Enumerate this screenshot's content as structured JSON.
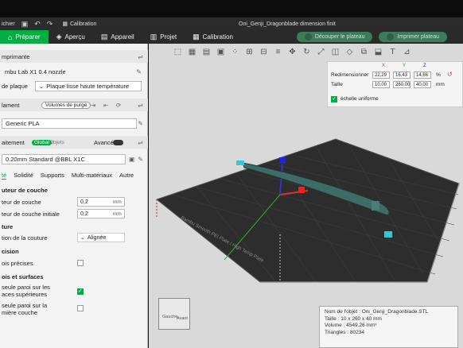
{
  "titlebar": {
    "menu": "ichier",
    "calibration": "Calibration",
    "filename": "Oni_Genji_Dragonblade dimension finit"
  },
  "tabs": [
    {
      "label": "Préparer",
      "icon": "home-icon"
    },
    {
      "label": "Aperçu",
      "icon": "layers-icon"
    },
    {
      "label": "Appareil",
      "icon": "device-icon"
    },
    {
      "label": "Projet",
      "icon": "project-icon"
    },
    {
      "label": "Calibration",
      "icon": "calibration-icon"
    }
  ],
  "actions": {
    "slice": "Découper le plateau",
    "print": "Imprimer plateau"
  },
  "left": {
    "printer_head": "mprimante",
    "printer_name": "mbu Lab X1 0.4 nozzle",
    "plate_label": "de plaque",
    "plate_value": "Plaque lisse haute température",
    "filament_label": "lament",
    "purge_label": "Volumes de purge",
    "filament_value": "Generic PLA",
    "process_label": "aitement",
    "global_label": "Global",
    "objets_label": "Objets",
    "avance_label": "Avancé",
    "profile_value": "0.20mm Standard @BBL X1C",
    "subtabs": [
      "té",
      "Solidité",
      "Supports",
      "Multi-matériaux",
      "Autre"
    ],
    "layer_head": "uteur de couche",
    "layer_height_label": "teur de couche",
    "layer_height_value": "0,2",
    "layer_height_unit": "mm",
    "first_layer_label": "teur de couche initiale",
    "first_layer_value": "0,2",
    "first_layer_unit": "mm",
    "seam_head": "ture",
    "seam_label": "tion de la couture",
    "seam_value": "Alignée",
    "precision_head": "cision",
    "precise_walls_label": "ois précises",
    "walls_head": "ois et surfaces",
    "single_wall_top_label1": "seule paroi sur les",
    "single_wall_top_label2": "aces supérieures",
    "single_wall_first_label1": "seule paroi sur la",
    "single_wall_first_label2": "mière couche"
  },
  "scale": {
    "axes": [
      "X",
      "Y",
      "Z"
    ],
    "resize_label": "Redimensionner",
    "resize_values": [
      "22,29",
      "16,43",
      "14,66"
    ],
    "resize_unit": "%",
    "size_label": "Taille",
    "size_values": [
      "10,00",
      "260,00",
      "40,00"
    ],
    "size_unit": "mm",
    "uniform_label": "échelle uniforme"
  },
  "info": {
    "name": "Nom de l'objet : Oni_Genji_Dragonblade.STL",
    "size": "Taille : 10 x 260 x 40 mm",
    "volume": "Volume : 4549.26 mm³",
    "triangles": "Triangles : 80234"
  },
  "cube": {
    "left": "Gauche",
    "front": "Avant"
  },
  "plate_text": "Bambu Smooth PEI Plate / High Temp Plate",
  "colors": {
    "accent": "#00ae42",
    "bed": "#2b2b2b"
  }
}
